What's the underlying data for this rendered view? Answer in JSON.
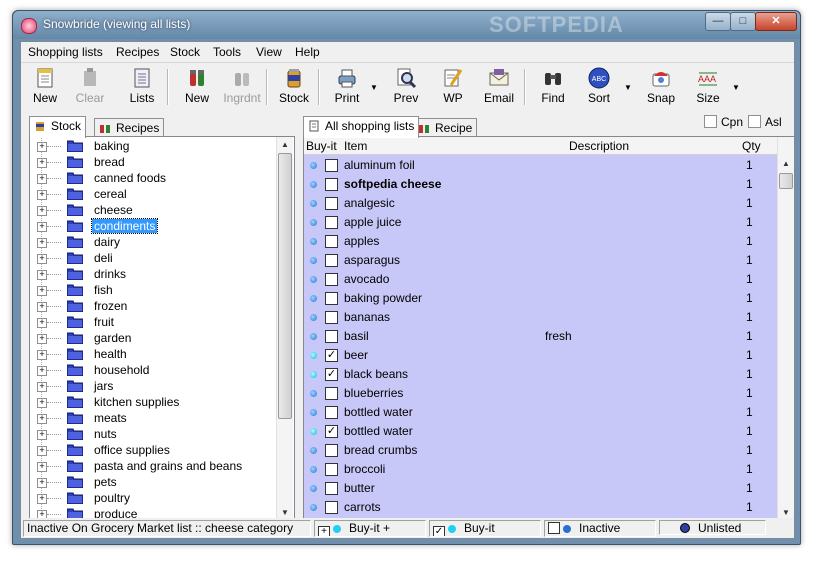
{
  "window": {
    "title": "Snowbride (viewing all lists)",
    "watermark": "SOFTPEDIA",
    "controls": {
      "minimize": "—",
      "maximize": "□",
      "close": "✕"
    }
  },
  "menu": [
    "Shopping lists",
    "Recipes",
    "Stock",
    "Tools",
    "View",
    "Help"
  ],
  "toolbar": {
    "new1": "New",
    "clear": "Clear",
    "lists": "Lists",
    "new2": "New",
    "ingrdnt": "Ingrdnt",
    "stock": "Stock",
    "print": "Print",
    "prev": "Prev",
    "wp": "WP",
    "email": "Email",
    "find": "Find",
    "sort": "Sort",
    "snap": "Snap",
    "size": "Size",
    "sort_icon_text": "ABC"
  },
  "left_tabs": {
    "stock": "Stock",
    "recipes": "Recipes"
  },
  "right_tabs": {
    "all_lists": "All shopping lists",
    "recipe": "Recipe"
  },
  "options": {
    "cpn": "Cpn",
    "asl": "Asl"
  },
  "tree": {
    "expand_symbol": "+",
    "items": [
      "baking",
      "bread",
      "canned foods",
      "cereal",
      "cheese",
      "condiments",
      "dairy",
      "deli",
      "drinks",
      "fish",
      "frozen",
      "fruit",
      "garden",
      "health",
      "household",
      "jars",
      "kitchen supplies",
      "meats",
      "nuts",
      "office supplies",
      "pasta and grains and beans",
      "pets",
      "poultry",
      "produce"
    ],
    "selected": "condiments"
  },
  "list": {
    "headers": {
      "buy": "Buy-it",
      "item": "Item",
      "description": "Description",
      "qty": "Qty"
    },
    "check_mark": "✓",
    "rows": [
      {
        "item": "aluminum foil",
        "desc": "",
        "qty": "1",
        "checked": false,
        "bold": false,
        "bright": false
      },
      {
        "item": "softpedia cheese",
        "desc": "",
        "qty": "1",
        "checked": false,
        "bold": true,
        "bright": false
      },
      {
        "item": "analgesic",
        "desc": "",
        "qty": "1",
        "checked": false,
        "bold": false,
        "bright": false
      },
      {
        "item": "apple juice",
        "desc": "",
        "qty": "1",
        "checked": false,
        "bold": false,
        "bright": false
      },
      {
        "item": "apples",
        "desc": "",
        "qty": "1",
        "checked": false,
        "bold": false,
        "bright": false
      },
      {
        "item": "asparagus",
        "desc": "",
        "qty": "1",
        "checked": false,
        "bold": false,
        "bright": false
      },
      {
        "item": "avocado",
        "desc": "",
        "qty": "1",
        "checked": false,
        "bold": false,
        "bright": false
      },
      {
        "item": "baking powder",
        "desc": "",
        "qty": "1",
        "checked": false,
        "bold": false,
        "bright": false
      },
      {
        "item": "bananas",
        "desc": "",
        "qty": "1",
        "checked": false,
        "bold": false,
        "bright": false
      },
      {
        "item": "basil",
        "desc": "fresh",
        "qty": "1",
        "checked": false,
        "bold": false,
        "bright": false
      },
      {
        "item": "beer",
        "desc": "",
        "qty": "1",
        "checked": true,
        "bold": false,
        "bright": true
      },
      {
        "item": "black beans",
        "desc": "",
        "qty": "1",
        "checked": true,
        "bold": false,
        "bright": true
      },
      {
        "item": "blueberries",
        "desc": "",
        "qty": "1",
        "checked": false,
        "bold": false,
        "bright": false
      },
      {
        "item": "bottled water",
        "desc": "",
        "qty": "1",
        "checked": false,
        "bold": false,
        "bright": false
      },
      {
        "item": "bottled water",
        "desc": "",
        "qty": "1",
        "checked": true,
        "bold": false,
        "bright": true
      },
      {
        "item": "bread crumbs",
        "desc": "",
        "qty": "1",
        "checked": false,
        "bold": false,
        "bright": false
      },
      {
        "item": "broccoli",
        "desc": "",
        "qty": "1",
        "checked": false,
        "bold": false,
        "bright": false
      },
      {
        "item": "butter",
        "desc": "",
        "qty": "1",
        "checked": false,
        "bold": false,
        "bright": false
      },
      {
        "item": "carrots",
        "desc": "",
        "qty": "1",
        "checked": false,
        "bold": false,
        "bright": false
      }
    ]
  },
  "status": {
    "message": "Inactive On Grocery Market list :: cheese category",
    "buy_plus": "Buy-it +",
    "buy": "Buy-it",
    "inactive": "Inactive",
    "unlisted": "Unlisted",
    "plus_symbol": "+",
    "check_symbol": "✓"
  },
  "colors": {
    "list_bg": "#c8c8f8",
    "selection": "#3399ff",
    "titlebar": "#7799b8"
  }
}
